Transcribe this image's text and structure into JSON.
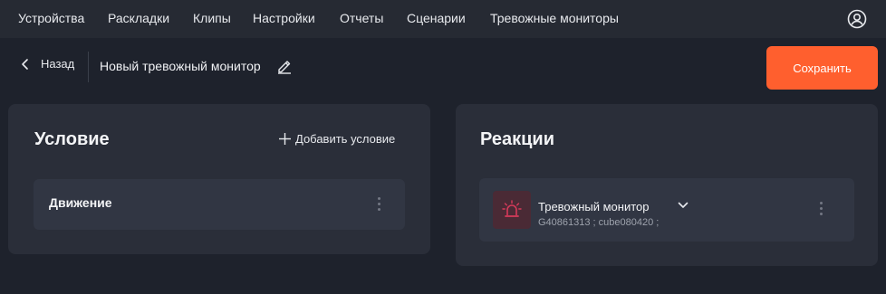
{
  "nav": {
    "items": [
      {
        "label": "Устройства"
      },
      {
        "label": "Раскладки"
      },
      {
        "label": "Клипы"
      },
      {
        "label": "Настройки"
      },
      {
        "label": "Отчеты"
      },
      {
        "label": "Сценарии"
      },
      {
        "label": "Тревожные мониторы"
      }
    ],
    "user_icon": "user-circle-icon"
  },
  "header": {
    "back_label": "Назад",
    "title": "Новый тревожный монитор",
    "save_label": "Сохранить"
  },
  "condition": {
    "title": "Условие",
    "add_label": "Добавить условие",
    "items": [
      {
        "label": "Движение"
      }
    ]
  },
  "reactions": {
    "title": "Реакции",
    "items": [
      {
        "title": "Тревожный монитор",
        "subtitle": "G40861313 ; cube080420 ;",
        "icon": "alarm-light-icon"
      }
    ]
  },
  "colors": {
    "accent": "#ff5f2e",
    "background": "#1e222c",
    "panel": "#2a2e39",
    "alarm": "#d63a5a"
  }
}
